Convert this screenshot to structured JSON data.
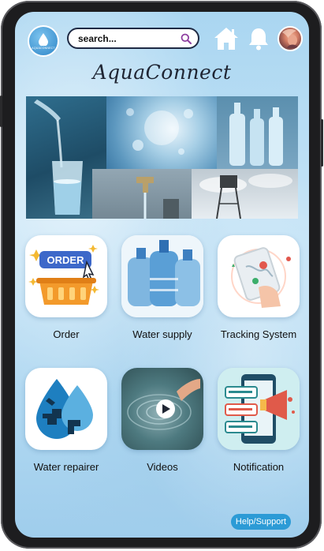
{
  "app": {
    "logo_text": "AQUACONNECT",
    "title": "AquaConnect"
  },
  "header": {
    "search_placeholder": "search...",
    "icons": [
      "home-icon",
      "bell-icon",
      "avatar"
    ]
  },
  "banner": {
    "images": [
      "glass-of-water",
      "water-splash",
      "water-bottles",
      "water-tap",
      "water-tower"
    ]
  },
  "features": [
    {
      "label": "Order",
      "icon": "order-basket-icon"
    },
    {
      "label": "Water  supply",
      "icon": "water-jugs-icon"
    },
    {
      "label": "Tracking System",
      "icon": "map-tracking-icon"
    },
    {
      "label": "Water repairer",
      "icon": "plumbing-drop-icon"
    },
    {
      "label": "Videos",
      "icon": "video-play-icon"
    },
    {
      "label": "Notification",
      "icon": "megaphone-notification-icon"
    }
  ],
  "order_badge": "ORDER",
  "help": {
    "label": "Help/Support"
  },
  "colors": {
    "background": "#b9def4",
    "accent": "#2c9bd6",
    "text": "#111111",
    "order_tile": "#f39a2b"
  }
}
